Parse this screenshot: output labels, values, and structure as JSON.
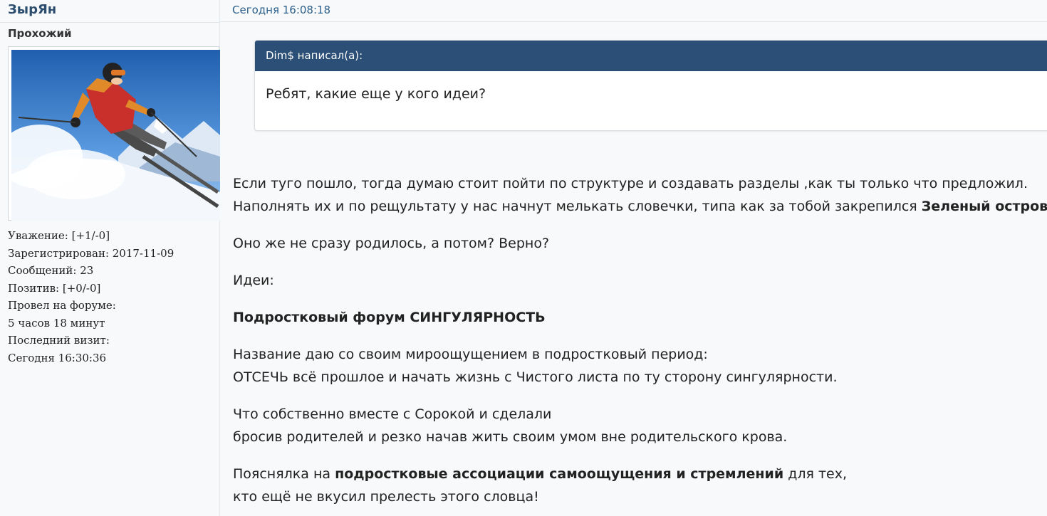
{
  "author": {
    "name": "ЗырЯн",
    "rank": "Прохожий",
    "stats": [
      "Уважение: [+1/-0]",
      "Зарегистрирован: 2017-11-09",
      "Сообщений: 23",
      "Позитив: [+0/-0]",
      "Провел на форуме:",
      "5 часов 18 минут",
      "Последний визит:",
      "Сегодня 16:30:36"
    ]
  },
  "post": {
    "date": "Сегодня 16:08:18",
    "quote": {
      "header": "Dim$ написал(а):",
      "text": "Ребят, какие еще у кого идеи?"
    },
    "paragraphs": {
      "p1_l1": "Если туго пошло, тогда думаю стоит пойти по структуре и создавать разделы ,как ты только что предложил.",
      "p1_l2_a": "Наполнять их и по рещультату у нас начнут мелькать словечки, типа как за тобой закрепился ",
      "p1_l2_b": "Зеленый остров.",
      "p1_l2_c": " .",
      "p2": "Оно же не сразу родилось, а потом?  Верно?",
      "p3": "Идеи:",
      "p4": "Подростковый форум СИНГУЛЯРНОСТЬ",
      "p5_l1": "Название даю со своим мироощущением в подростковый период:",
      "p5_l2": "ОТСЕЧЬ всё прошлое и начать жизнь с Чистого листа по ту сторону сингулярности.",
      "p6_l1": "Что собственно вместе с Сорокой и сделали",
      "p6_l2": "бросив родителей и резко начав жить своим умом вне родительского крова.",
      "p7_l1_a": "Пояснялка на ",
      "p7_l1_b": "подростковые ассоциации самоощущения и стремлений",
      "p7_l1_c": " для тех,",
      "p7_l2": "кто ещё не вкусил прелесть этого словца!"
    }
  }
}
